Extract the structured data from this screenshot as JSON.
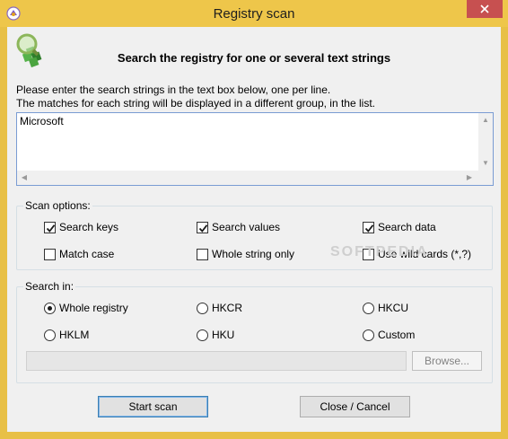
{
  "window": {
    "title": "Registry scan",
    "close_glyph": "✕",
    "title_bar_color": "#eec64a"
  },
  "header": {
    "icon": "magnifier-registry-icon",
    "headline": "Search the registry for one or several text strings"
  },
  "instructions": {
    "line1": "Please enter the search strings in the text box below, one per line.",
    "line2": "The matches for each string will be displayed in a different group, in the list."
  },
  "search_strings": {
    "value": "Microsoft"
  },
  "scan_options": {
    "legend": "Scan options:",
    "search_keys": {
      "label": "Search keys",
      "checked": true
    },
    "search_values": {
      "label": "Search values",
      "checked": true
    },
    "search_data": {
      "label": "Search data",
      "checked": true
    },
    "match_case": {
      "label": "Match case",
      "checked": false
    },
    "whole_string_only": {
      "label": "Whole string only",
      "checked": false
    },
    "use_wild_cards": {
      "label": "Use wild cards (*,?)",
      "checked": false
    }
  },
  "search_in": {
    "legend": "Search in:",
    "selected": "Whole registry",
    "options": [
      "Whole registry",
      "HKCR",
      "HKCU",
      "HKLM",
      "HKU",
      "Custom"
    ],
    "custom_path": "",
    "browse_label": "Browse..."
  },
  "buttons": {
    "start_scan": "Start scan",
    "close_cancel": "Close / Cancel"
  },
  "watermark": "SOFTPEDIA"
}
